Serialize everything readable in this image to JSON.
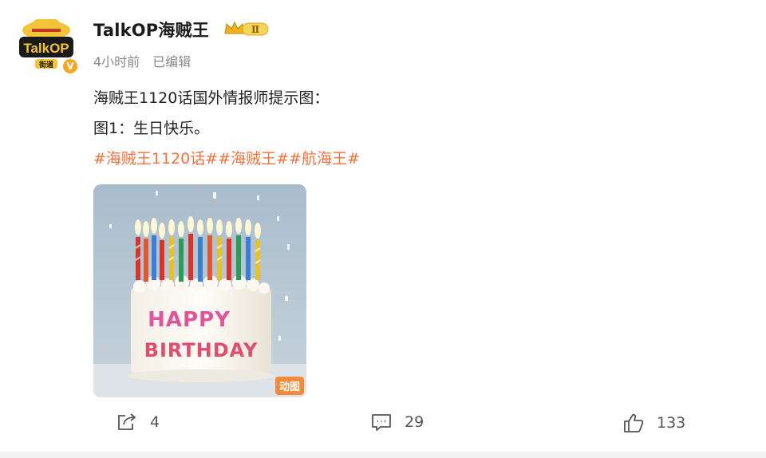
{
  "post": {
    "username": "TalkOP海贼王",
    "level_badge": "Ⅱ",
    "verified_mark": "V",
    "time": "4小时前",
    "edited": "已编辑",
    "line1": "海贼王1120话国外情报师提示图：",
    "line2": "图1：生日快乐。",
    "hashtags": [
      "#海贼王1120话#",
      "#海贼王#",
      "#航海王#"
    ],
    "media": {
      "badge": "动图",
      "cake_text_line1": "HAPPY",
      "cake_text_line2": "BIRTHDAY",
      "avatar_logo_text": "TalkOP",
      "avatar_sub_text": "街道"
    }
  },
  "actions": {
    "share_count": "4",
    "comment_count": "29",
    "like_count": "133"
  },
  "colors": {
    "hashtag": "#eb7340",
    "gif_badge": "#f08b3d",
    "verified": "#f5a623"
  }
}
